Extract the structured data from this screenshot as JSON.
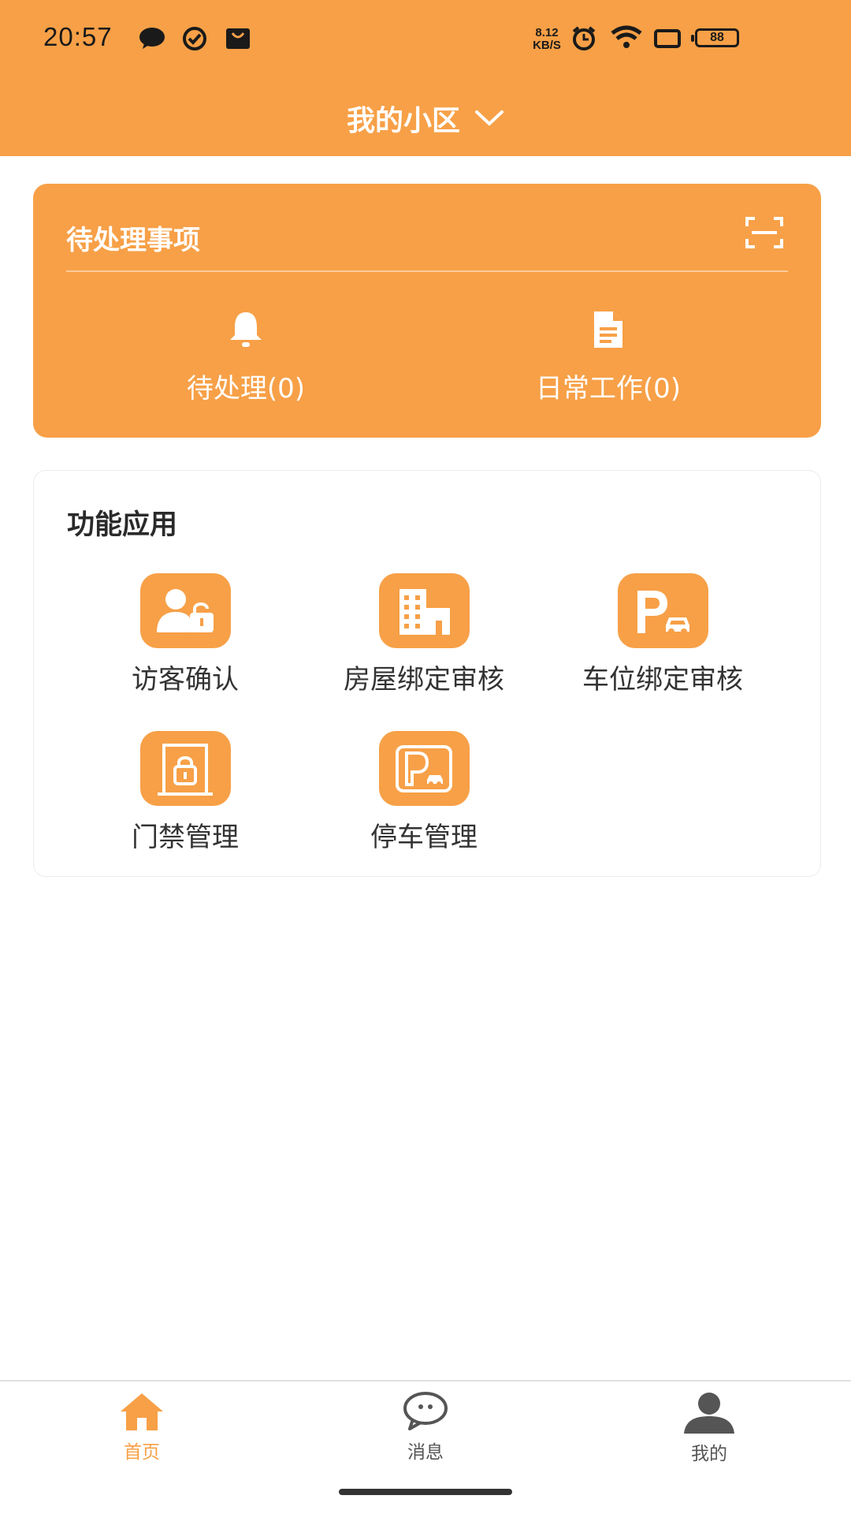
{
  "status_bar": {
    "time": "20:57",
    "net_speed_value": "8.12",
    "net_speed_unit": "KB/S",
    "battery": "88",
    "icons": [
      "chat-bubble-icon",
      "check-circle-icon",
      "shopping-bag-icon",
      "alarm-icon",
      "wifi-icon",
      "screen-icon",
      "battery-icon"
    ]
  },
  "header": {
    "title": "我的小区",
    "dropdown_icon": "chevron-down-icon"
  },
  "pending": {
    "title": "待处理事项",
    "scan_icon": "scan-icon",
    "items": [
      {
        "label": "待处理(0)",
        "icon": "bell-icon"
      },
      {
        "label": "日常工作(0)",
        "icon": "document-icon"
      }
    ]
  },
  "functions": {
    "title": "功能应用",
    "items": [
      {
        "label": "访客确认",
        "icon": "visitor-lock-icon"
      },
      {
        "label": "房屋绑定审核",
        "icon": "building-icon"
      },
      {
        "label": "车位绑定审核",
        "icon": "parking-car-icon"
      },
      {
        "label": "门禁管理",
        "icon": "door-lock-icon"
      },
      {
        "label": "停车管理",
        "icon": "parking-frame-icon"
      }
    ]
  },
  "tabbar": {
    "items": [
      {
        "label": "首页",
        "icon": "home-icon",
        "active": true
      },
      {
        "label": "消息",
        "icon": "message-icon",
        "active": false
      },
      {
        "label": "我的",
        "icon": "user-icon",
        "active": false
      }
    ]
  },
  "colors": {
    "accent": "#F7A047",
    "tab_active": "#F7A047",
    "tab_inactive": "#555555"
  }
}
